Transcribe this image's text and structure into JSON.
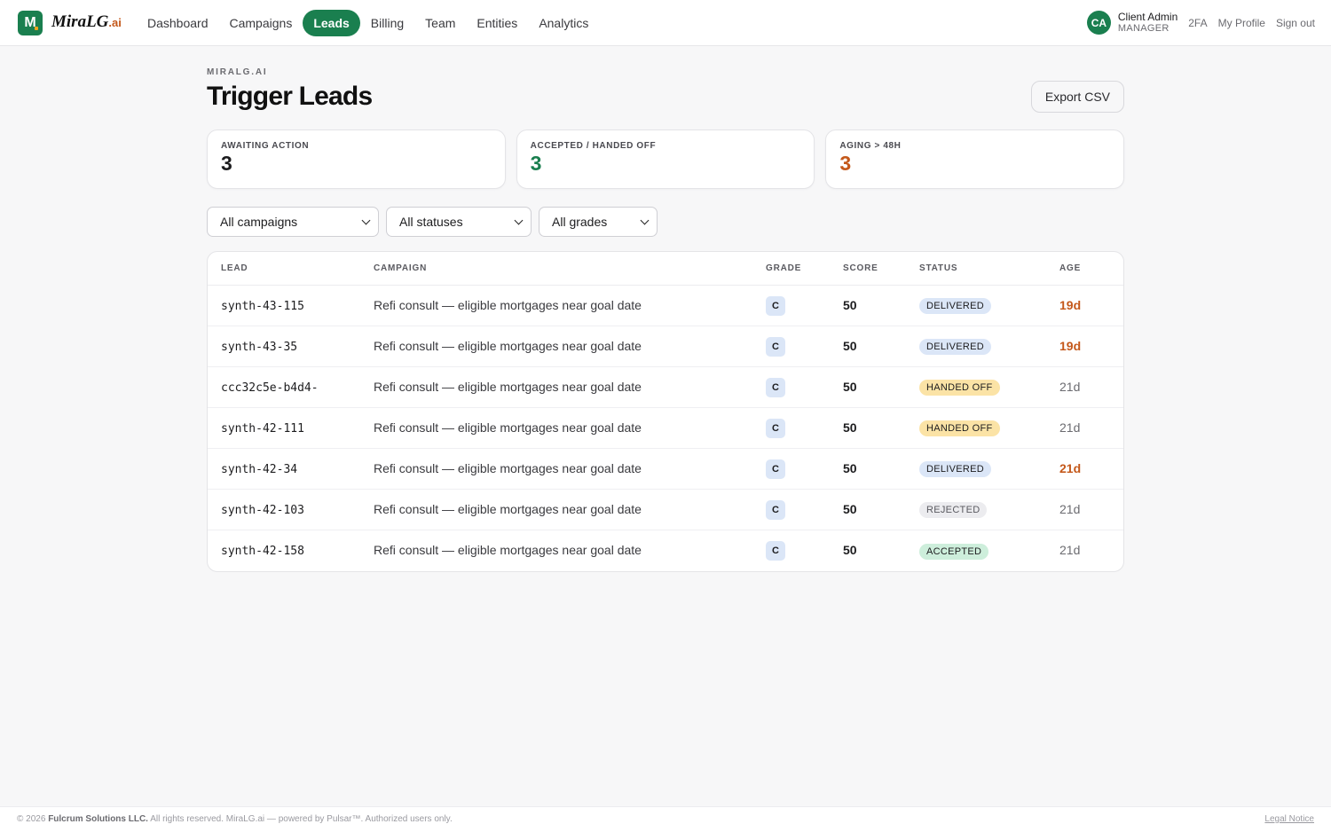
{
  "brand": {
    "mark": "M",
    "name": "MiraLG",
    "suffix": ".ai"
  },
  "nav": {
    "items": [
      {
        "label": "Dashboard"
      },
      {
        "label": "Campaigns"
      },
      {
        "label": "Leads"
      },
      {
        "label": "Billing"
      },
      {
        "label": "Team"
      },
      {
        "label": "Entities"
      },
      {
        "label": "Analytics"
      }
    ],
    "active": "Leads"
  },
  "user": {
    "initials": "CA",
    "name": "Client Admin",
    "role": "MANAGER"
  },
  "top_links": {
    "twofa": "2FA",
    "profile": "My Profile",
    "signout": "Sign out"
  },
  "page": {
    "eyebrow": "MIRALG.AI",
    "title": "Trigger Leads",
    "export_label": "Export CSV"
  },
  "stats": [
    {
      "label": "AWAITING ACTION",
      "value": "3",
      "color": "#1c1c1e"
    },
    {
      "label": "ACCEPTED / HANDED OFF",
      "value": "3",
      "color": "#1a7f4f"
    },
    {
      "label": "AGING > 48H",
      "value": "3",
      "color": "#c4581a"
    }
  ],
  "filters": {
    "campaign": "All campaigns",
    "status": "All statuses",
    "grade": "All grades"
  },
  "table": {
    "headers": {
      "lead": "LEAD",
      "campaign": "CAMPAIGN",
      "grade": "GRADE",
      "score": "SCORE",
      "status": "STATUS",
      "age": "AGE"
    },
    "rows": [
      {
        "lead": "synth-43-115",
        "campaign": "Refi consult — eligible mortgages near goal date",
        "grade": "C",
        "score": "50",
        "status": "DELIVERED",
        "age": "19d"
      },
      {
        "lead": "synth-43-35",
        "campaign": "Refi consult — eligible mortgages near goal date",
        "grade": "C",
        "score": "50",
        "status": "DELIVERED",
        "age": "19d"
      },
      {
        "lead": "ccc32c5e-b4d4-",
        "campaign": "Refi consult — eligible mortgages near goal date",
        "grade": "C",
        "score": "50",
        "status": "HANDED OFF",
        "age": "21d"
      },
      {
        "lead": "synth-42-111",
        "campaign": "Refi consult — eligible mortgages near goal date",
        "grade": "C",
        "score": "50",
        "status": "HANDED OFF",
        "age": "21d"
      },
      {
        "lead": "synth-42-34",
        "campaign": "Refi consult — eligible mortgages near goal date",
        "grade": "C",
        "score": "50",
        "status": "DELIVERED",
        "age": "21d"
      },
      {
        "lead": "synth-42-103",
        "campaign": "Refi consult — eligible mortgages near goal date",
        "grade": "C",
        "score": "50",
        "status": "REJECTED",
        "age": "21d"
      },
      {
        "lead": "synth-42-158",
        "campaign": "Refi consult — eligible mortgages near goal date",
        "grade": "C",
        "score": "50",
        "status": "ACCEPTED",
        "age": "21d"
      }
    ]
  },
  "status_colors": {
    "DELIVERED": "#dbe6f7",
    "HANDED OFF": "#fbe3a6",
    "REJECTED": "#ececef",
    "ACCEPTED": "#cdeedb"
  },
  "age_highlight_color": "#c4581a",
  "footer": {
    "year": "© 2026",
    "company": "Fulcrum Solutions LLC.",
    "rest": "All rights reserved. MiraLG.ai — powered by Pulsar™. Authorized users only.",
    "legal": "Legal Notice"
  }
}
